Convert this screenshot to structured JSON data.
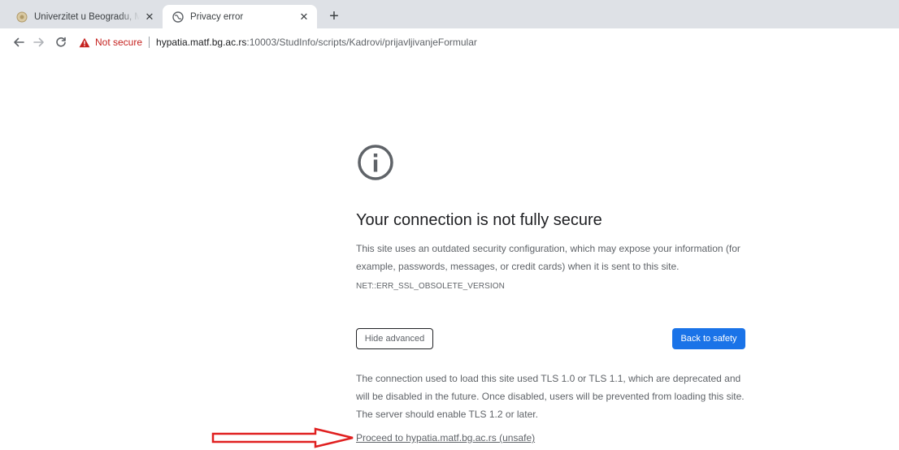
{
  "tabs": [
    {
      "title": "Univerzitet u Beogradu, Matematički fakultet",
      "active": false,
      "favicon": "university-favicon"
    },
    {
      "title": "Privacy error",
      "active": true,
      "favicon": "globe-icon"
    }
  ],
  "toolbar": {
    "security_label": "Not secure",
    "url_host": "hypatia.matf.bg.ac.rs",
    "url_path": ":10003/StudInfo/scripts/Kadrovi/prijavljivanjeFormular"
  },
  "interstitial": {
    "heading": "Your connection is not fully secure",
    "description": "This site uses an outdated security configuration, which may expose your information (for example, passwords, messages, or credit cards) when it is sent to this site.",
    "error_code": "NET::ERR_SSL_OBSOLETE_VERSION",
    "hide_advanced_label": "Hide advanced",
    "back_to_safety_label": "Back to safety",
    "advanced_text": "The connection used to load this site used TLS 1.0 or TLS 1.1, which are deprecated and will be disabled in the future. Once disabled, users will be prevented from loading this site. The server should enable TLS 1.2 or later.",
    "proceed_link": "Proceed to hypatia.matf.bg.ac.rs (unsafe)"
  },
  "colors": {
    "primary_button": "#1a73e8",
    "warning": "#c5221f",
    "annotation_arrow": "#e02020"
  }
}
